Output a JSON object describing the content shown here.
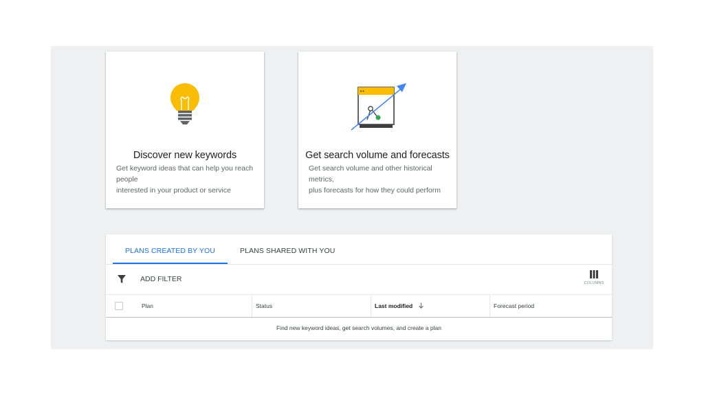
{
  "cards": [
    {
      "title": "Discover new keywords",
      "desc_line1": "Get keyword ideas that can help you reach people",
      "desc_line2": "interested in your product or service",
      "icon": "lightbulb-icon"
    },
    {
      "title": "Get search volume and forecasts",
      "desc_line1": "Get search volume and other historical metrics,",
      "desc_line2": "plus forecasts for how they could perform",
      "icon": "chart-trend-icon"
    }
  ],
  "tabs": {
    "created": "PLANS CREATED BY YOU",
    "shared": "PLANS SHARED WITH YOU"
  },
  "toolbar": {
    "add_filter": "ADD FILTER",
    "columns_label": "COLUMNS"
  },
  "table": {
    "headers": {
      "plan": "Plan",
      "status": "Status",
      "last_modified": "Last modified",
      "forecast_period": "Forecast period"
    },
    "empty_message": "Find new keyword ideas, get search volumes, and create a plan"
  },
  "colors": {
    "accent": "#1a73e8",
    "bulb": "#fbbc04",
    "green": "#34a853",
    "background": "#eef0f2"
  }
}
